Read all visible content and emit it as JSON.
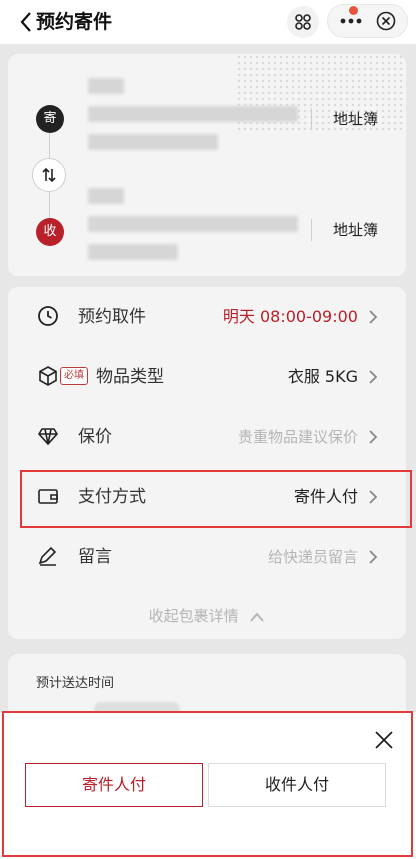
{
  "nav": {
    "title": "预约寄件"
  },
  "address": {
    "sender_badge": "寄",
    "receiver_badge": "收",
    "sender_book": "地址簿",
    "receiver_book": "地址簿"
  },
  "options": {
    "pickup": {
      "label": "预约取件",
      "value": "明天 08:00-09:00"
    },
    "item": {
      "label": "物品类型",
      "tag": "必填",
      "value": "衣服 5KG"
    },
    "insure": {
      "label": "保价",
      "value": "贵重物品建议保价"
    },
    "payment": {
      "label": "支付方式",
      "value": "寄件人付"
    },
    "note": {
      "label": "留言",
      "value": "给快递员留言"
    },
    "collapse_label": "收起包裹详情"
  },
  "eta": {
    "label": "预计送达时间"
  },
  "sheet": {
    "option_sender": "寄件人付",
    "option_receiver": "收件人付"
  },
  "colors": {
    "accent_red": "#b8202a",
    "highlight_red": "#e23a3a"
  }
}
